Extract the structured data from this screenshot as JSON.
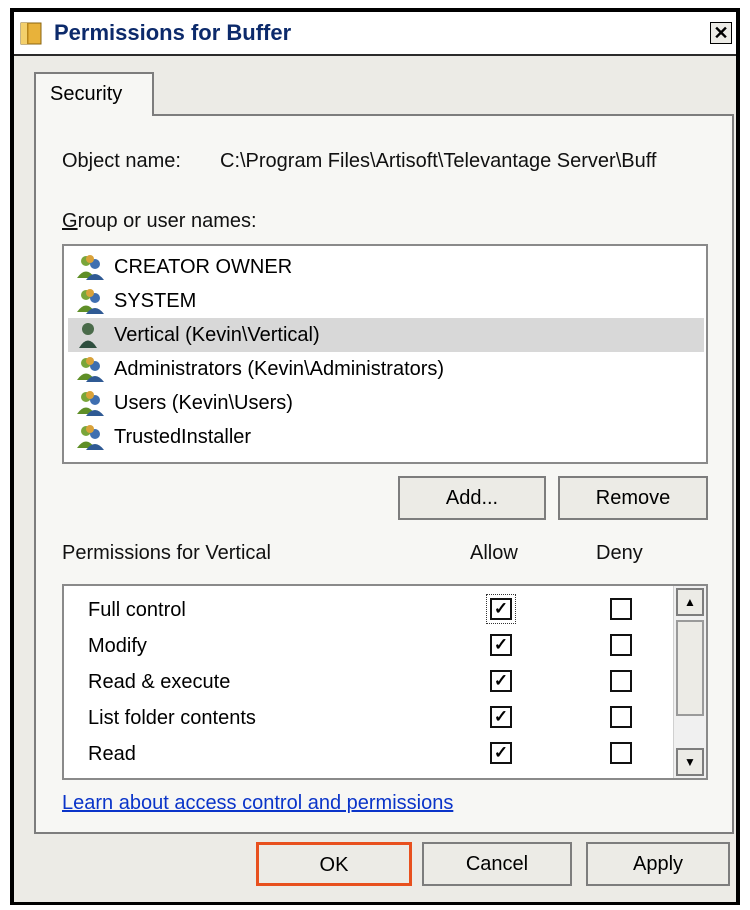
{
  "window": {
    "title": "Permissions for Buffer",
    "close_glyph": "✕",
    "icon": "folder-icon"
  },
  "tabs": [
    {
      "label": "Security",
      "selected": true
    }
  ],
  "object": {
    "label": "Object name:",
    "value": "C:\\Program Files\\Artisoft\\Televantage Server\\Buff"
  },
  "groups": {
    "label": "Group or user names:",
    "items": [
      {
        "label": "CREATOR OWNER",
        "icon": "group-users-icon",
        "selected": false
      },
      {
        "label": "SYSTEM",
        "icon": "group-users-icon",
        "selected": false
      },
      {
        "label": "Vertical (Kevin\\Vertical)",
        "icon": "single-user-icon",
        "selected": true
      },
      {
        "label": "Administrators (Kevin\\Administrators)",
        "icon": "group-users-icon",
        "selected": false
      },
      {
        "label": "Users (Kevin\\Users)",
        "icon": "group-users-icon",
        "selected": false
      },
      {
        "label": "TrustedInstaller",
        "icon": "group-users-icon",
        "selected": false
      }
    ]
  },
  "buttons": {
    "add": "Add...",
    "remove": "Remove",
    "ok": "OK",
    "cancel": "Cancel",
    "apply": "Apply"
  },
  "permissions": {
    "label": "Permissions for Vertical",
    "allow_header": "Allow",
    "deny_header": "Deny",
    "rows": [
      {
        "name": "Full control",
        "allow": true,
        "deny": false
      },
      {
        "name": "Modify",
        "allow": true,
        "deny": false
      },
      {
        "name": "Read & execute",
        "allow": true,
        "deny": false
      },
      {
        "name": "List folder contents",
        "allow": true,
        "deny": false
      },
      {
        "name": "Read",
        "allow": true,
        "deny": false
      }
    ]
  },
  "link": {
    "label": "Learn about access control and permissions"
  },
  "colors": {
    "title_text": "#0c2a6b",
    "link": "#0a34c9",
    "ok_highlight": "#e8501e",
    "selected_row": "#d8d8d8"
  }
}
